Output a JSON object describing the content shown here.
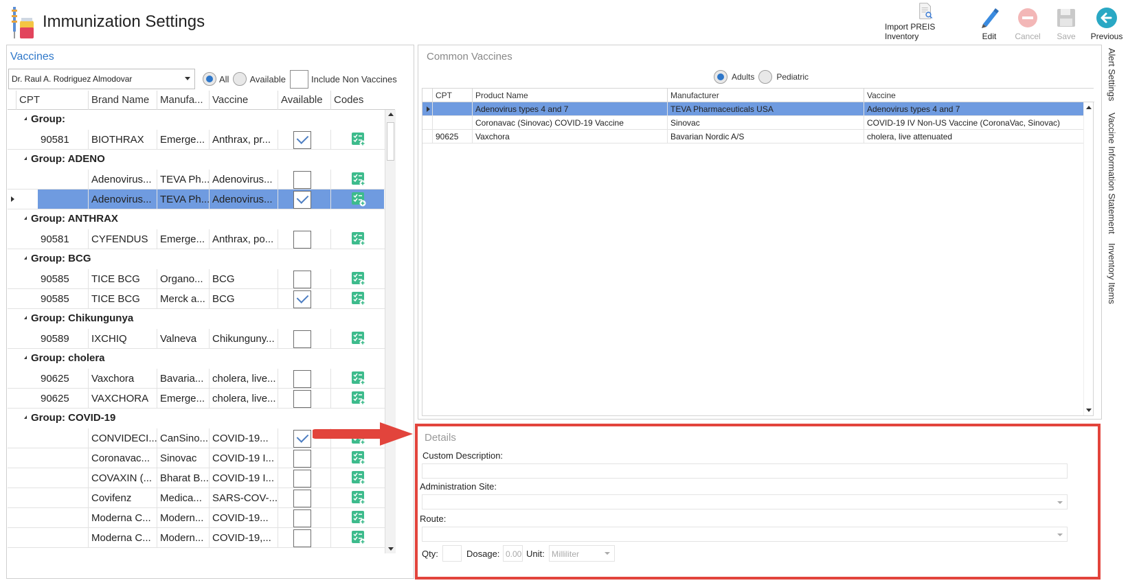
{
  "app": {
    "title": "Immunization Settings"
  },
  "toolbar": {
    "import_label": "Import PREIS Inventory",
    "edit_label": "Edit",
    "cancel_label": "Cancel",
    "save_label": "Save",
    "previous_label": "Previous"
  },
  "vaccines": {
    "title": "Vaccines",
    "provider": "Dr. Raul A. Rodriguez Almodovar",
    "filter_all": "All",
    "filter_available": "Available",
    "include_non_vaccines": "Include Non Vaccines",
    "columns": [
      "CPT",
      "Brand Name",
      "Manufa...",
      "Vaccine",
      "Available",
      "Codes"
    ],
    "rows": [
      {
        "type": "group",
        "label": "Group:"
      },
      {
        "type": "item",
        "cpt": "90581",
        "brand": "BIOTHRAX",
        "manufacturer": "Emerge...",
        "vaccine": "Anthrax, pr...",
        "available": true
      },
      {
        "type": "group",
        "label": "Group: ADENO"
      },
      {
        "type": "item",
        "cpt": "",
        "brand": "Adenovirus...",
        "manufacturer": "TEVA Ph...",
        "vaccine": "Adenovirus...",
        "available": false
      },
      {
        "type": "item",
        "cpt": "",
        "brand": "Adenovirus...",
        "manufacturer": "TEVA Ph...",
        "vaccine": "Adenovirus...",
        "available": true,
        "selected": true
      },
      {
        "type": "group",
        "label": "Group: ANTHRAX"
      },
      {
        "type": "item",
        "cpt": "90581",
        "brand": "CYFENDUS",
        "manufacturer": "Emerge...",
        "vaccine": "Anthrax, po...",
        "available": false
      },
      {
        "type": "group",
        "label": "Group: BCG"
      },
      {
        "type": "item",
        "cpt": "90585",
        "brand": "TICE BCG",
        "manufacturer": "Organo...",
        "vaccine": "BCG",
        "available": false
      },
      {
        "type": "item",
        "cpt": "90585",
        "brand": "TICE BCG",
        "manufacturer": "Merck a...",
        "vaccine": "BCG",
        "available": true
      },
      {
        "type": "group",
        "label": "Group: Chikungunya"
      },
      {
        "type": "item",
        "cpt": "90589",
        "brand": "IXCHIQ",
        "manufacturer": "Valneva",
        "vaccine": "Chikunguny...",
        "available": false
      },
      {
        "type": "group",
        "label": "Group: cholera"
      },
      {
        "type": "item",
        "cpt": "90625",
        "brand": "Vaxchora",
        "manufacturer": "Bavaria...",
        "vaccine": "cholera, live...",
        "available": false
      },
      {
        "type": "item",
        "cpt": "90625",
        "brand": "VAXCHORA",
        "manufacturer": "Emerge...",
        "vaccine": "cholera, live...",
        "available": false
      },
      {
        "type": "group",
        "label": "Group: COVID-19"
      },
      {
        "type": "item",
        "cpt": "",
        "brand": "CONVIDECI...",
        "manufacturer": "CanSino...",
        "vaccine": "COVID-19...",
        "available": true
      },
      {
        "type": "item",
        "cpt": "",
        "brand": "Coronavac...",
        "manufacturer": "Sinovac",
        "vaccine": "COVID-19 I...",
        "available": false
      },
      {
        "type": "item",
        "cpt": "",
        "brand": "COVAXIN (...",
        "manufacturer": "Bharat B...",
        "vaccine": "COVID-19 I...",
        "available": false
      },
      {
        "type": "item",
        "cpt": "",
        "brand": "Covifenz",
        "manufacturer": "Medica...",
        "vaccine": "SARS-COV-...",
        "available": false
      },
      {
        "type": "item",
        "cpt": "",
        "brand": "Moderna C...",
        "manufacturer": "Modern...",
        "vaccine": "COVID-19...",
        "available": false
      },
      {
        "type": "item",
        "cpt": "",
        "brand": "Moderna C...",
        "manufacturer": "Modern...",
        "vaccine": "COVID-19,...",
        "available": false
      }
    ]
  },
  "common": {
    "title": "Common Vaccines",
    "filter_adults": "Adults",
    "filter_pediatric": "Pediatric",
    "columns": [
      "CPT",
      "Product Name",
      "Manufacturer",
      "Vaccine"
    ],
    "rows": [
      {
        "cpt": "",
        "product": "Adenovirus types 4 and 7",
        "manufacturer": "TEVA Pharmaceuticals USA",
        "vaccine": "Adenovirus types 4 and 7",
        "selected": true
      },
      {
        "cpt": "",
        "product": "Coronavac (Sinovac) COVID-19 Vaccine",
        "manufacturer": "Sinovac",
        "vaccine": "COVID-19 IV Non-US Vaccine (CoronaVac, Sinovac)"
      },
      {
        "cpt": "90625",
        "product": "Vaxchora",
        "manufacturer": "Bavarian Nordic A/S",
        "vaccine": "cholera, live attenuated"
      }
    ]
  },
  "details": {
    "title": "Details",
    "custom_description_label": "Custom Description:",
    "administration_site_label": "Administration Site:",
    "route_label": "Route:",
    "qty_label": "Qty:",
    "dosage_label": "Dosage:",
    "dosage_value": "0.00",
    "unit_label": "Unit:",
    "unit_value": "Milliliter"
  },
  "side_tabs": [
    "Alert Settings",
    "Vaccine Information Statement",
    "Inventory Items"
  ],
  "colors": {
    "accent": "#2e77c9",
    "selection": "#6f9be0",
    "highlight_border": "#e2443c",
    "codes_icon": "#3dbb8c"
  }
}
